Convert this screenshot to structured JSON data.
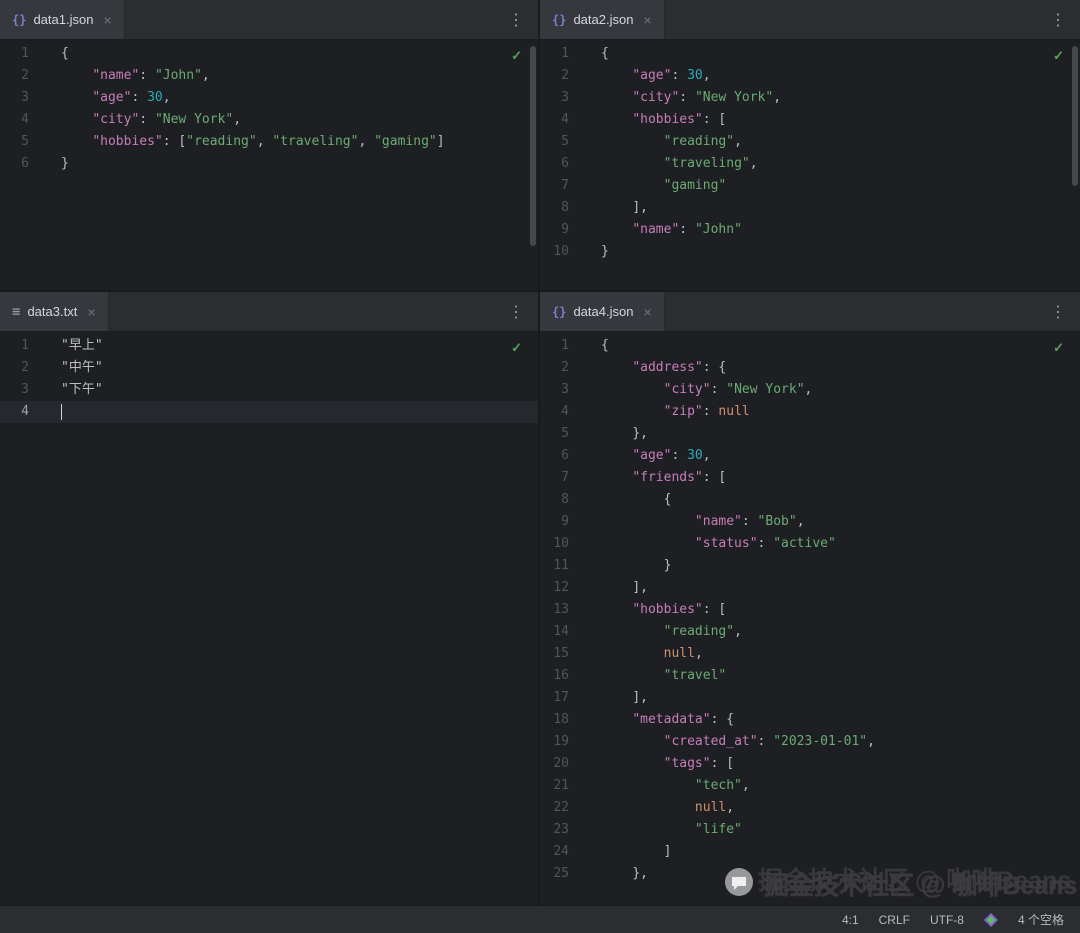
{
  "icons": {
    "json_file": "{}",
    "text_file": "≡",
    "close": "×",
    "more": "⋮",
    "check": "✓"
  },
  "colors": {
    "editor_bg": "#1e1f22",
    "tab_bar_bg": "#2b2d30",
    "active_tab_bg": "#36383d",
    "json_key": "#c77dbb",
    "string": "#6aab73",
    "number": "#2aacb8",
    "null": "#cf8e6d",
    "punctuation": "#bcbec4",
    "line_number": "#50545c",
    "current_line_bg": "#26282e",
    "check_ok": "#55a25d",
    "json_icon": "#7a7fd0"
  },
  "panes": [
    {
      "tab": {
        "label": "data1.json"
      },
      "lines": [
        {
          "num": 1,
          "tokens": [
            [
              "p",
              "{"
            ]
          ]
        },
        {
          "num": 2,
          "tokens": [
            [
              "ws",
              "    "
            ],
            [
              "k",
              "\"name\""
            ],
            [
              "p",
              ": "
            ],
            [
              "s",
              "\"John\""
            ],
            [
              "p",
              ","
            ]
          ]
        },
        {
          "num": 3,
          "tokens": [
            [
              "ws",
              "    "
            ],
            [
              "k",
              "\"age\""
            ],
            [
              "p",
              ": "
            ],
            [
              "n",
              "30"
            ],
            [
              "p",
              ","
            ]
          ]
        },
        {
          "num": 4,
          "tokens": [
            [
              "ws",
              "    "
            ],
            [
              "k",
              "\"city\""
            ],
            [
              "p",
              ": "
            ],
            [
              "s",
              "\"New York\""
            ],
            [
              "p",
              ","
            ]
          ]
        },
        {
          "num": 5,
          "tokens": [
            [
              "ws",
              "    "
            ],
            [
              "k",
              "\"hobbies\""
            ],
            [
              "p",
              ": ["
            ],
            [
              "s",
              "\"reading\""
            ],
            [
              "p",
              ", "
            ],
            [
              "s",
              "\"traveling\""
            ],
            [
              "p",
              ", "
            ],
            [
              "s",
              "\"gaming\""
            ],
            [
              "p",
              "]"
            ]
          ]
        },
        {
          "num": 6,
          "tokens": [
            [
              "p",
              "}"
            ]
          ]
        }
      ]
    },
    {
      "tab": {
        "label": "data2.json"
      },
      "lines": [
        {
          "num": 1,
          "tokens": [
            [
              "p",
              "{"
            ]
          ]
        },
        {
          "num": 2,
          "tokens": [
            [
              "ws",
              "    "
            ],
            [
              "k",
              "\"age\""
            ],
            [
              "p",
              ": "
            ],
            [
              "n",
              "30"
            ],
            [
              "p",
              ","
            ]
          ]
        },
        {
          "num": 3,
          "tokens": [
            [
              "ws",
              "    "
            ],
            [
              "k",
              "\"city\""
            ],
            [
              "p",
              ": "
            ],
            [
              "s",
              "\"New York\""
            ],
            [
              "p",
              ","
            ]
          ]
        },
        {
          "num": 4,
          "tokens": [
            [
              "ws",
              "    "
            ],
            [
              "k",
              "\"hobbies\""
            ],
            [
              "p",
              ": ["
            ]
          ]
        },
        {
          "num": 5,
          "tokens": [
            [
              "ws",
              "        "
            ],
            [
              "s",
              "\"reading\""
            ],
            [
              "p",
              ","
            ]
          ]
        },
        {
          "num": 6,
          "tokens": [
            [
              "ws",
              "        "
            ],
            [
              "s",
              "\"traveling\""
            ],
            [
              "p",
              ","
            ]
          ]
        },
        {
          "num": 7,
          "tokens": [
            [
              "ws",
              "        "
            ],
            [
              "s",
              "\"gaming\""
            ]
          ]
        },
        {
          "num": 8,
          "tokens": [
            [
              "ws",
              "    "
            ],
            [
              "p",
              "],"
            ]
          ]
        },
        {
          "num": 9,
          "tokens": [
            [
              "ws",
              "    "
            ],
            [
              "k",
              "\"name\""
            ],
            [
              "p",
              ": "
            ],
            [
              "s",
              "\"John\""
            ]
          ]
        },
        {
          "num": 10,
          "tokens": [
            [
              "p",
              "}"
            ]
          ]
        }
      ]
    },
    {
      "tab": {
        "label": "data3.txt"
      },
      "active_line": 4,
      "lines": [
        {
          "num": 1,
          "tokens": [
            [
              "d",
              "\"早上\""
            ]
          ]
        },
        {
          "num": 2,
          "tokens": [
            [
              "d",
              "\"中午\""
            ]
          ]
        },
        {
          "num": 3,
          "tokens": [
            [
              "d",
              "\"下午\""
            ]
          ]
        },
        {
          "num": 4,
          "tokens": []
        }
      ]
    },
    {
      "tab": {
        "label": "data4.json"
      },
      "lines": [
        {
          "num": 1,
          "tokens": [
            [
              "p",
              "{"
            ]
          ]
        },
        {
          "num": 2,
          "tokens": [
            [
              "ws",
              "    "
            ],
            [
              "k",
              "\"address\""
            ],
            [
              "p",
              ": {"
            ]
          ]
        },
        {
          "num": 3,
          "tokens": [
            [
              "ws",
              "        "
            ],
            [
              "k",
              "\"city\""
            ],
            [
              "p",
              ": "
            ],
            [
              "s",
              "\"New York\""
            ],
            [
              "p",
              ","
            ]
          ]
        },
        {
          "num": 4,
          "tokens": [
            [
              "ws",
              "        "
            ],
            [
              "k",
              "\"zip\""
            ],
            [
              "p",
              ": "
            ],
            [
              "u",
              "null"
            ]
          ]
        },
        {
          "num": 5,
          "tokens": [
            [
              "ws",
              "    "
            ],
            [
              "p",
              "},"
            ]
          ]
        },
        {
          "num": 6,
          "tokens": [
            [
              "ws",
              "    "
            ],
            [
              "k",
              "\"age\""
            ],
            [
              "p",
              ": "
            ],
            [
              "n",
              "30"
            ],
            [
              "p",
              ","
            ]
          ]
        },
        {
          "num": 7,
          "tokens": [
            [
              "ws",
              "    "
            ],
            [
              "k",
              "\"friends\""
            ],
            [
              "p",
              ": ["
            ]
          ]
        },
        {
          "num": 8,
          "tokens": [
            [
              "ws",
              "        "
            ],
            [
              "p",
              "{"
            ]
          ]
        },
        {
          "num": 9,
          "tokens": [
            [
              "ws",
              "            "
            ],
            [
              "k",
              "\"name\""
            ],
            [
              "p",
              ": "
            ],
            [
              "s",
              "\"Bob\""
            ],
            [
              "p",
              ","
            ]
          ]
        },
        {
          "num": 10,
          "tokens": [
            [
              "ws",
              "            "
            ],
            [
              "k",
              "\"status\""
            ],
            [
              "p",
              ": "
            ],
            [
              "s",
              "\"active\""
            ]
          ]
        },
        {
          "num": 11,
          "tokens": [
            [
              "ws",
              "        "
            ],
            [
              "p",
              "}"
            ]
          ]
        },
        {
          "num": 12,
          "tokens": [
            [
              "ws",
              "    "
            ],
            [
              "p",
              "],"
            ]
          ]
        },
        {
          "num": 13,
          "tokens": [
            [
              "ws",
              "    "
            ],
            [
              "k",
              "\"hobbies\""
            ],
            [
              "p",
              ": ["
            ]
          ]
        },
        {
          "num": 14,
          "tokens": [
            [
              "ws",
              "        "
            ],
            [
              "s",
              "\"reading\""
            ],
            [
              "p",
              ","
            ]
          ]
        },
        {
          "num": 15,
          "tokens": [
            [
              "ws",
              "        "
            ],
            [
              "u",
              "null"
            ],
            [
              "p",
              ","
            ]
          ]
        },
        {
          "num": 16,
          "tokens": [
            [
              "ws",
              "        "
            ],
            [
              "s",
              "\"travel\""
            ]
          ]
        },
        {
          "num": 17,
          "tokens": [
            [
              "ws",
              "    "
            ],
            [
              "p",
              "],"
            ]
          ]
        },
        {
          "num": 18,
          "tokens": [
            [
              "ws",
              "    "
            ],
            [
              "k",
              "\"metadata\""
            ],
            [
              "p",
              ": {"
            ]
          ]
        },
        {
          "num": 19,
          "tokens": [
            [
              "ws",
              "        "
            ],
            [
              "k",
              "\"created_at\""
            ],
            [
              "p",
              ": "
            ],
            [
              "s",
              "\"2023-01-01\""
            ],
            [
              "p",
              ","
            ]
          ]
        },
        {
          "num": 20,
          "tokens": [
            [
              "ws",
              "        "
            ],
            [
              "k",
              "\"tags\""
            ],
            [
              "p",
              ": ["
            ]
          ]
        },
        {
          "num": 21,
          "tokens": [
            [
              "ws",
              "            "
            ],
            [
              "s",
              "\"tech\""
            ],
            [
              "p",
              ","
            ]
          ]
        },
        {
          "num": 22,
          "tokens": [
            [
              "ws",
              "            "
            ],
            [
              "u",
              "null"
            ],
            [
              "p",
              ","
            ]
          ]
        },
        {
          "num": 23,
          "tokens": [
            [
              "ws",
              "            "
            ],
            [
              "s",
              "\"life\""
            ]
          ]
        },
        {
          "num": 24,
          "tokens": [
            [
              "ws",
              "        "
            ],
            [
              "p",
              "]"
            ]
          ]
        },
        {
          "num": 25,
          "tokens": [
            [
              "ws",
              "    "
            ],
            [
              "p",
              "},"
            ]
          ]
        }
      ]
    }
  ],
  "status": {
    "position": "4:1",
    "line_separator": "CRLF",
    "encoding": "UTF-8",
    "indent": "4 个空格"
  },
  "watermark": {
    "text": "掘金技术社区 @ 咖啡Beans"
  }
}
